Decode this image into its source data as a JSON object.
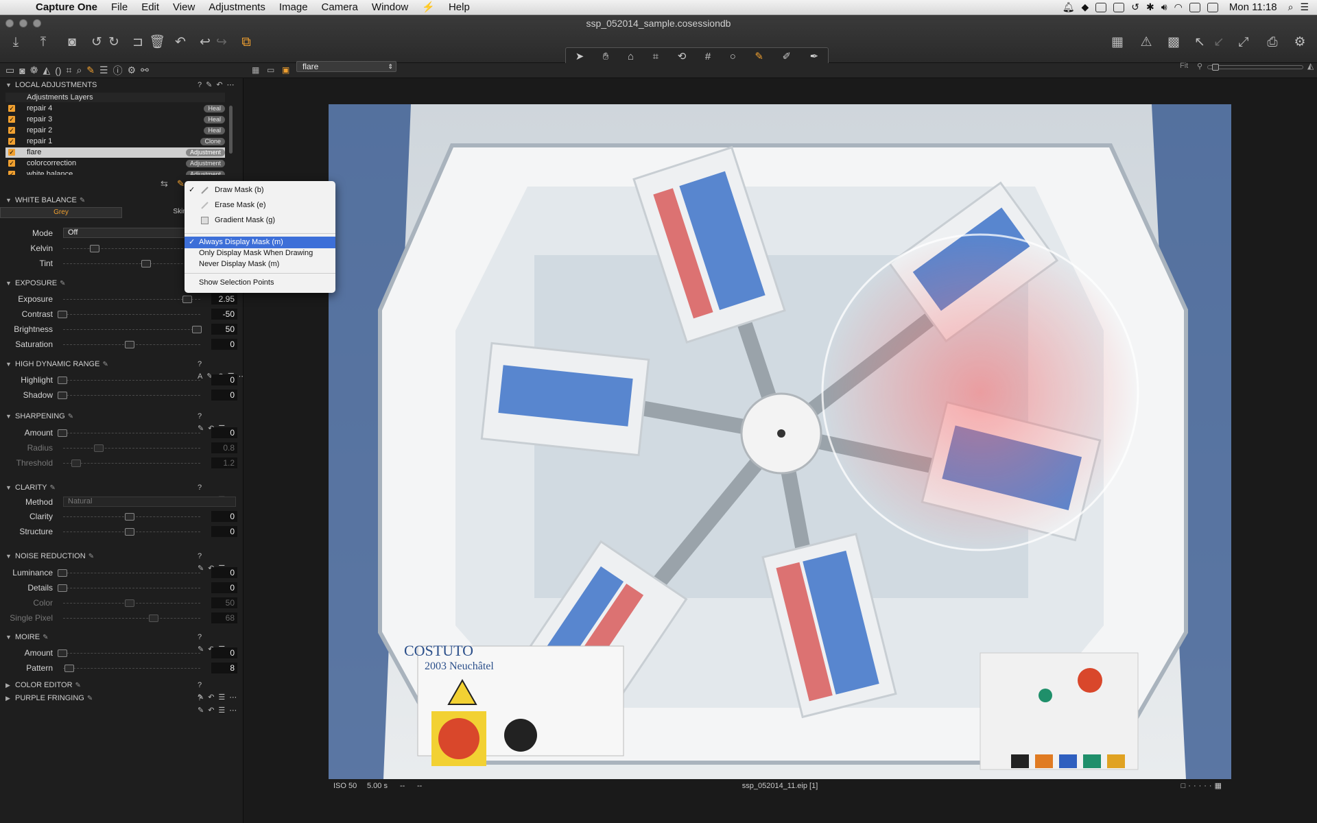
{
  "menubar": {
    "app": "Capture One",
    "items": [
      "File",
      "Edit",
      "View",
      "Adjustments",
      "Image",
      "Camera",
      "Window",
      "Help"
    ],
    "clock": "Mon 11:18"
  },
  "window": {
    "title": "ssp_052014_sample.cosessiondb"
  },
  "variant_selector": {
    "value": "flare"
  },
  "viewer": {
    "fit_label": "Fit"
  },
  "local_adjustments": {
    "title": "LOCAL ADJUSTMENTS",
    "layers_header": "Adjustments Layers",
    "layers": [
      {
        "name": "repair 4",
        "tag": "Heal"
      },
      {
        "name": "repair 3",
        "tag": "Heal"
      },
      {
        "name": "repair 2",
        "tag": "Heal"
      },
      {
        "name": "repair 1",
        "tag": "Clone"
      },
      {
        "name": "flare",
        "tag": "Adjustment"
      },
      {
        "name": "colorcorrection",
        "tag": "Adjustment"
      },
      {
        "name": "white balance",
        "tag": "Adjustment"
      }
    ]
  },
  "mask_menu": {
    "items": [
      "Draw Mask (b)",
      "Erase Mask (e)",
      "Gradient Mask (g)"
    ],
    "display": [
      "Always Display Mask (m)",
      "Only Display Mask When Drawing",
      "Never Display Mask (m)"
    ],
    "selection": "Show Selection Points"
  },
  "white_balance": {
    "title": "WHITE BALANCE",
    "tab_grey": "Grey",
    "tab_skin": "Skin T",
    "mode_label": "Mode",
    "mode_value": "Off",
    "kelvin": "Kelvin",
    "tint": "Tint"
  },
  "exposure": {
    "title": "EXPOSURE",
    "rows": [
      {
        "label": "Exposure",
        "value": "2.95",
        "pos": 0.93
      },
      {
        "label": "Contrast",
        "value": "-50",
        "pos": 0.0
      },
      {
        "label": "Brightness",
        "value": "50",
        "pos": 1.0
      },
      {
        "label": "Saturation",
        "value": "0",
        "pos": 0.5
      }
    ]
  },
  "hdr": {
    "title": "HIGH DYNAMIC RANGE",
    "rows": [
      {
        "label": "Highlight",
        "value": "0",
        "pos": 0
      },
      {
        "label": "Shadow",
        "value": "0",
        "pos": 0
      }
    ]
  },
  "sharpening": {
    "title": "SHARPENING",
    "rows": [
      {
        "label": "Amount",
        "value": "0",
        "pos": 0
      },
      {
        "label": "Radius",
        "value": "0.8",
        "pos": 0.27
      },
      {
        "label": "Threshold",
        "value": "1.2",
        "pos": 0.1
      }
    ]
  },
  "clarity": {
    "title": "CLARITY",
    "method_label": "Method",
    "method_value": "Natural",
    "rows": [
      {
        "label": "Clarity",
        "value": "0",
        "pos": 0.5
      },
      {
        "label": "Structure",
        "value": "0",
        "pos": 0.5
      }
    ]
  },
  "noise": {
    "title": "NOISE REDUCTION",
    "rows": [
      {
        "label": "Luminance",
        "value": "0",
        "pos": 0
      },
      {
        "label": "Details",
        "value": "0",
        "pos": 0
      },
      {
        "label": "Color",
        "value": "50",
        "pos": 0.5
      },
      {
        "label": "Single Pixel",
        "value": "68",
        "pos": 0.68
      }
    ]
  },
  "moire": {
    "title": "MOIRE",
    "rows": [
      {
        "label": "Amount",
        "value": "0",
        "pos": 0
      },
      {
        "label": "Pattern",
        "value": "8",
        "pos": 0.05
      }
    ]
  },
  "color_editor": {
    "title": "COLOR EDITOR"
  },
  "purple_fringing": {
    "title": "PURPLE FRINGING"
  },
  "photo": {
    "brand": "COSTUTO",
    "city": "2003 Neuchâtel"
  },
  "infobar": {
    "iso": "ISO 50",
    "shutter": "5.00 s",
    "aperture": "--",
    "focal": "--",
    "filename": "ssp_052014_11.eip [1]"
  }
}
